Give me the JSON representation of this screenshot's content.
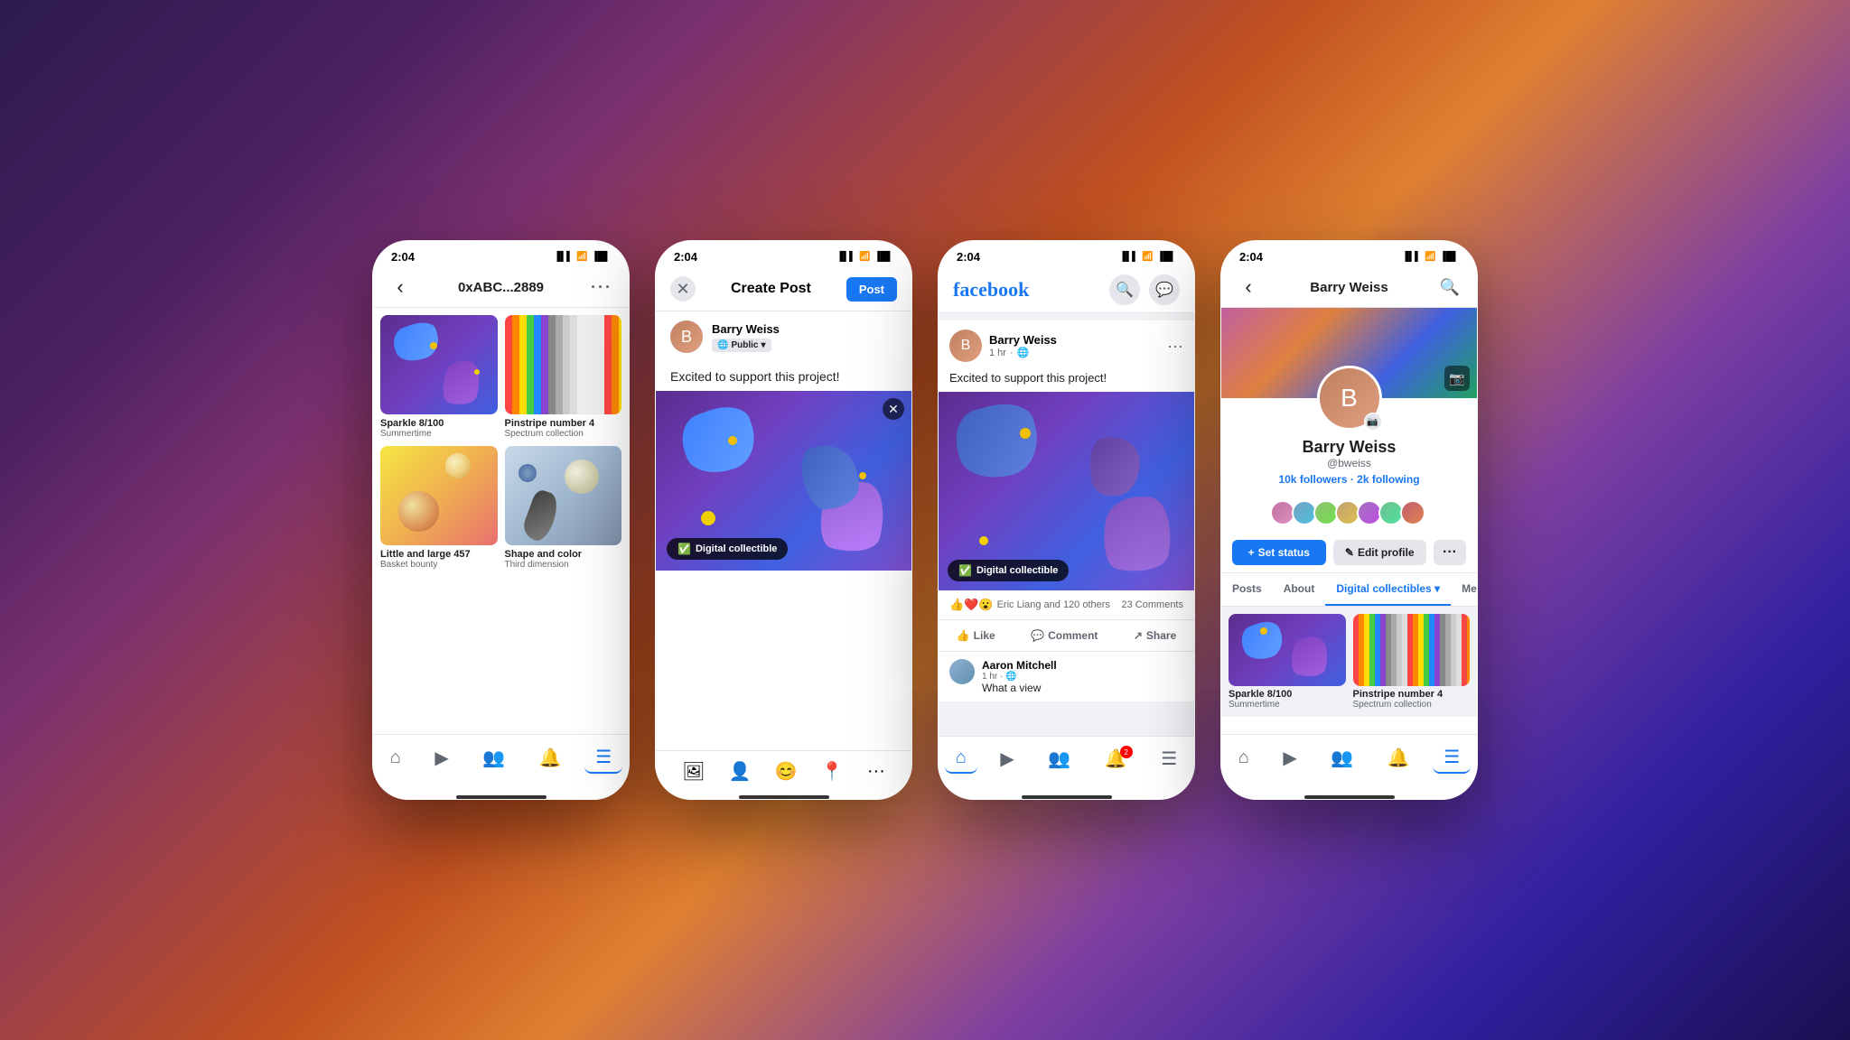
{
  "background": {
    "gradient": "linear-gradient(135deg, #2d1b4e, #c05020, #8040a0, #1a1050)"
  },
  "phone1": {
    "status_time": "2:04",
    "title": "0xABC...2889",
    "nav_back": "‹",
    "nav_more": "···",
    "items": [
      {
        "title": "Sparkle 8/100",
        "subtitle": "Summertime",
        "art": "sparkle"
      },
      {
        "title": "Pinstripe number 4",
        "subtitle": "Spectrum collection",
        "art": "pinstripe"
      },
      {
        "title": "Little and large 457",
        "subtitle": "Basket bounty",
        "art": "little"
      },
      {
        "title": "Shape and color",
        "subtitle": "Third dimension",
        "art": "shape"
      }
    ],
    "nav_items": [
      "🏠",
      "▶",
      "👥",
      "🔔",
      "☰"
    ]
  },
  "phone2": {
    "status_time": "2:04",
    "title": "Create Post",
    "close_label": "✕",
    "post_button": "Post",
    "author_name": "Barry Weiss",
    "privacy": "Public",
    "post_text": "Excited to support this project!",
    "badge_text": "Digital collectible",
    "tools": [
      "🖼",
      "👤",
      "😊",
      "📍",
      "···"
    ]
  },
  "phone3": {
    "status_time": "2:04",
    "fb_logo": "facebook",
    "post": {
      "author": "Barry Weiss",
      "time": "1 hr",
      "text": "Excited to support this project!",
      "badge": "Digital collectible",
      "reactions_text": "Eric Liang and 120 others",
      "comments": "23 Comments",
      "actions": [
        "Like",
        "Comment",
        "Share"
      ]
    },
    "comment": {
      "author": "Aaron Mitchell",
      "time": "1 hr",
      "preview": "What a view"
    }
  },
  "phone4": {
    "status_time": "2:04",
    "profile_name": "Barry Weiss",
    "handle": "@bweiss",
    "followers": "10k",
    "following": "2k",
    "stats_text": "followers · 2k following",
    "action_status": "+ Set status",
    "action_edit": "✎ Edit profile",
    "tabs": [
      "Posts",
      "About",
      "Digital collectibles",
      "Mentions"
    ],
    "items": [
      {
        "title": "Sparkle 8/100",
        "subtitle": "Summertime",
        "art": "sparkle"
      },
      {
        "title": "Pinstripe number 4",
        "subtitle": "Spectrum collection",
        "art": "pinstripe"
      }
    ]
  }
}
